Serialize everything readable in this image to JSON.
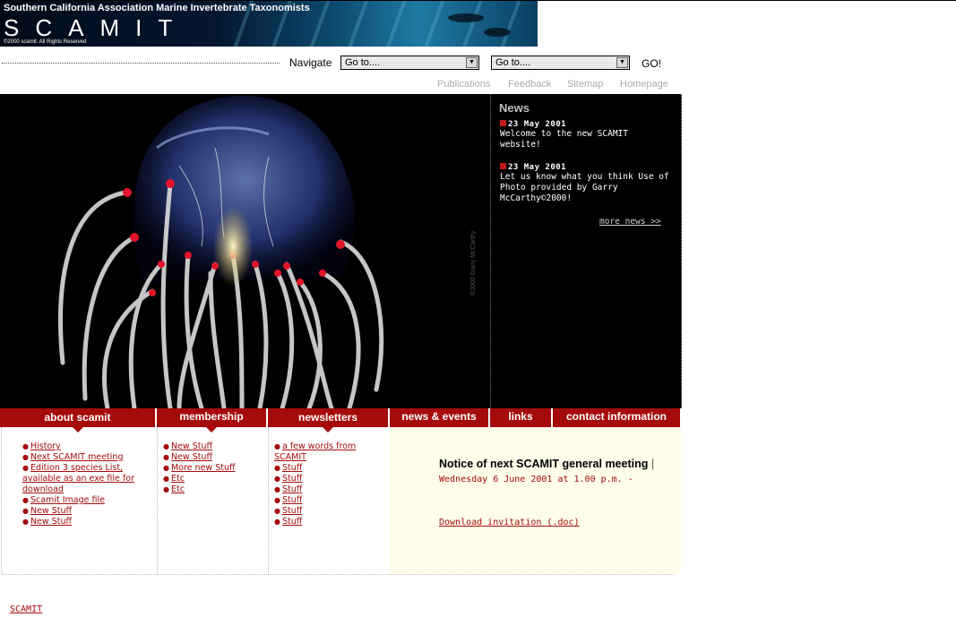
{
  "banner": {
    "org": "Southern California Association Marine Invertebrate Taxonomists",
    "name": "SCAMIT",
    "copyright": "©2000 scamit.  All Rights Reserved"
  },
  "nav": {
    "label": "Navigate",
    "select1": "Go to....",
    "select2": "Go to....",
    "go": "GO!"
  },
  "toplinks": [
    "Publications",
    "Feedback",
    "Sitemap",
    "Homepage"
  ],
  "hero": {
    "credit": "©2000 Garry McCarthy"
  },
  "news": {
    "heading": "News",
    "items": [
      {
        "date": "23 May 2001",
        "text": "Welcome to the new SCAMIT website!"
      },
      {
        "date": "23 May 2001",
        "text": "Let us know what you think  Use of Photo provided by Garry McCarthy©2000!"
      }
    ],
    "more": "more news >>"
  },
  "tabs": [
    "about scamit",
    "membership",
    "newsletters",
    "news & events",
    "links",
    "contact information"
  ],
  "columns": {
    "about": [
      "History",
      "Next SCAMIT meeting",
      "Edition 3 species List, available as an exe file for download",
      "Scamit Image file",
      "New Stuff",
      "New Stuff"
    ],
    "membership": [
      "New Stuff",
      "New Stuff",
      "More new Stuff",
      "Etc",
      "Etc"
    ],
    "newsletters": [
      "a few words from SCAMIT",
      "Stuff",
      "Stuff",
      "Stuff",
      "Stuff",
      "Stuff",
      "Stuff"
    ]
  },
  "notice": {
    "title": "Notice of next SCAMIT general meeting",
    "date": "Wednesday 6 June 2001 at 1.00 p.m. -",
    "download": "Download invitation (.doc)"
  },
  "footer": {
    "link": "SCAMIT"
  },
  "colors": {
    "accent": "#a50b0b",
    "notice_bg": "#fdfde8"
  }
}
